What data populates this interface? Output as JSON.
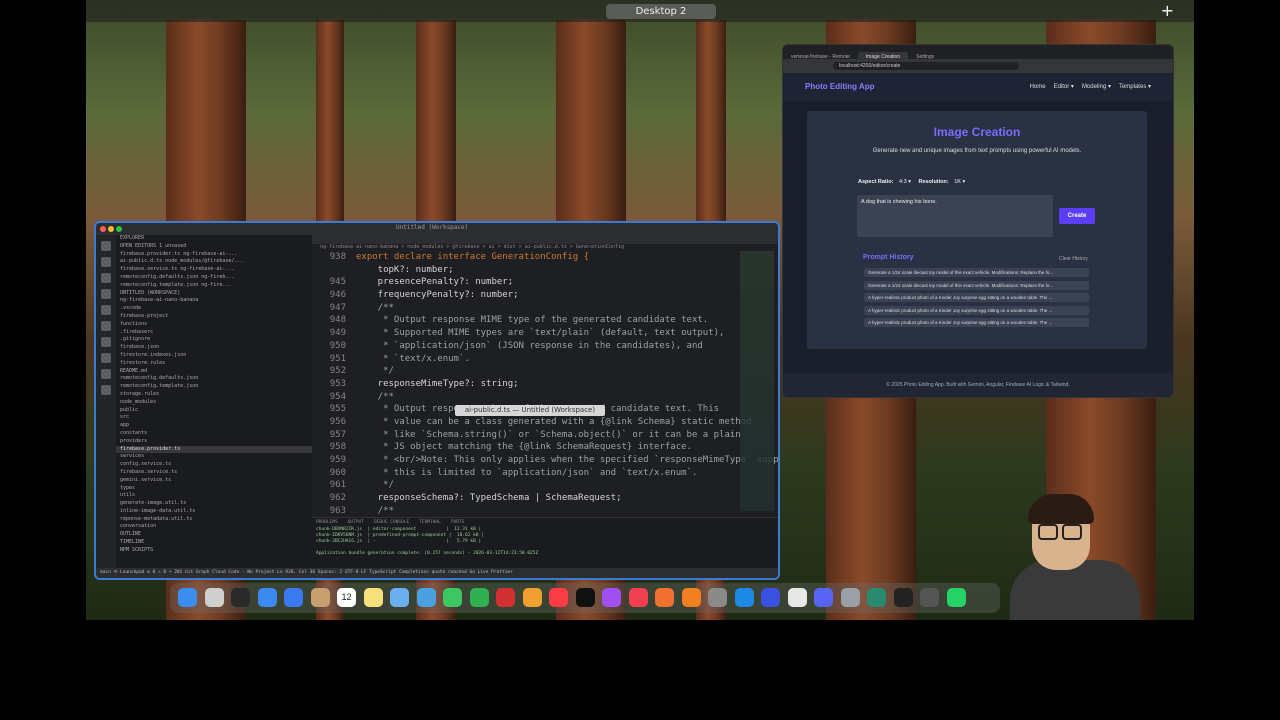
{
  "desktop": {
    "space_label": "Desktop 2",
    "add_label": "+"
  },
  "vscode": {
    "title": "Untitled (Workspace)",
    "explorer": [
      "EXPLORER",
      "OPEN EDITORS  1 unsaved",
      "  firebase.provider.ts  ng-firebase-ai-...",
      "  ai-public.d.ts  node_modules/@firebase/...",
      "  firebase.service.ts  ng-firebase-ai-...",
      "  remoteconfig.defaults.json  ng-fireb...",
      "  remoteconfig.template.json  ng-fire...",
      "UNTITLED (WORKSPACE)",
      "  ng-firebase-ai-nano-banana",
      "    .vscode",
      "    firebase-project",
      "      functions",
      "      .firebaserc",
      "      .gitignore",
      "      firebase.json",
      "      firestore.indexes.json",
      "      firestore.rules",
      "      README.md",
      "      remoteconfig.defaults.json",
      "      remoteconfig.template.json",
      "      storage.rules",
      "    node_modules",
      "    public",
      "    src",
      "      app",
      "        constants",
      "        providers",
      "          firebase.provider.ts",
      "        services",
      "          config.service.ts",
      "          firebase.service.ts",
      "          gemini.service.ts",
      "        types",
      "        utils",
      "          generate-image.util.ts",
      "          inline-image-data.util.ts",
      "          reponse-metadata.util.ts",
      "    conversation",
      "  OUTLINE",
      "  TIMELINE",
      "  NPM SCRIPTS"
    ],
    "tabs": [
      "firebase.provider.ts",
      "ai-public.d.ts",
      "firebase.service.ts",
      "remoteconfig.defaults.json",
      "remoteconfig.template.json"
    ],
    "breadcrumb": "ng-firebase-ai-nano-banana > node_modules > @firebase > ai > dist > ai-public.d.ts > GenerationConfig",
    "code": [
      {
        "n": "938",
        "t": "export declare interface GenerationConfig {",
        "k": "hdr"
      },
      {
        "n": "",
        "t": "    topK?: number;",
        "k": "plain"
      },
      {
        "n": "945",
        "t": "    presencePenalty?: number;",
        "k": "plain"
      },
      {
        "n": "946",
        "t": "    frequencyPenalty?: number;",
        "k": "plain"
      },
      {
        "n": "947",
        "t": "    /**",
        "k": "cm"
      },
      {
        "n": "948",
        "t": "     * Output response MIME type of the generated candidate text.",
        "k": "cm"
      },
      {
        "n": "949",
        "t": "     * Supported MIME types are `text/plain` (default, text output),",
        "k": "cm"
      },
      {
        "n": "950",
        "t": "     * `application/json` (JSON response in the candidates), and",
        "k": "cm"
      },
      {
        "n": "951",
        "t": "     * `text/x.enum`.",
        "k": "cm"
      },
      {
        "n": "952",
        "t": "     */",
        "k": "cm"
      },
      {
        "n": "953",
        "t": "    responseMimeType?: string;",
        "k": "plain"
      },
      {
        "n": "954",
        "t": "    /**",
        "k": "cm"
      },
      {
        "n": "955",
        "t": "     * Output response schema of the generated candidate text. This",
        "k": "cm"
      },
      {
        "n": "956",
        "t": "     * value can be a class generated with a {@link Schema} static method",
        "k": "cm"
      },
      {
        "n": "957",
        "t": "     * like `Schema.string()` or `Schema.object()` or it can be a plain",
        "k": "cm"
      },
      {
        "n": "958",
        "t": "     * JS object matching the {@link SchemaRequest} interface.",
        "k": "cm"
      },
      {
        "n": "959",
        "t": "     * <br/>Note: This only applies when the specified `responseMimeType` supports a schema;",
        "k": "cm"
      },
      {
        "n": "960",
        "t": "     * this is limited to `application/json` and `text/x.enum`.",
        "k": "cm"
      },
      {
        "n": "961",
        "t": "     */",
        "k": "cm"
      },
      {
        "n": "962",
        "t": "    responseSchema?: TypedSchema | SchemaRequest;",
        "k": "plain"
      },
      {
        "n": "963",
        "t": "    /**",
        "k": "cm"
      }
    ],
    "tooltip": "ai-public.d.ts — Untitled (Workspace)",
    "panel_tabs": [
      "PROBLEMS",
      "OUTPUT",
      "DEBUG CONSOLE",
      "TERMINAL",
      "PORTS"
    ],
    "terminal": [
      "chunk-DBVNR2IK.js  | editor-component           |  12.31 kB |",
      "chunk-IDKV56NM.js  | predefined-prompt-component |  10.62 kB |",
      "chunk-2BC2HAC6.js  | -                          |   5.79 kB |",
      "",
      "Application bundle generation complete. [0.157 seconds] - 2026-03-12T14:23:50.025Z"
    ],
    "statusbar": "main  ⟲  Launchpad  ⊗ 0 ⚠ 0  ⑂ 285  Git Graph  Cloud Code - No Project          Ln 938, Col 36   Spaces: 2   UTF-8   LF   TypeScript   Completions quota reached   Go Live   Prettier"
  },
  "chrome": {
    "tabs": [
      "vertexai-firebase - Remote",
      "Image Creation",
      "Settings"
    ],
    "address": "localhost:4200/editor/create",
    "app": {
      "brand": "Photo Editing App",
      "menu": [
        "Home",
        "Editor ▾",
        "Modeling ▾",
        "Templates ▾"
      ],
      "title": "Image Creation",
      "subtitle": "Generate new and unique images from text prompts using powerful AI models.",
      "aspect_label": "Aspect Ratio:",
      "aspect_value": "4:3",
      "resolution_label": "Resolution:",
      "resolution_value": "1K",
      "prompt_value": "A dog that is chewing his bone.",
      "create_label": "Create",
      "history_title": "Prompt History",
      "clear_label": "Clear History",
      "history": [
        "Generate a 1/24 scale diecast toy model of this exact vehicle. Modifications: Replace the fo...",
        "Generate a 1/24 scale diecast toy model of this exact vehicle. Modifications: Replace the fo...",
        "A hyper-realistic product photo of a Kinder Joy surprise egg sitting on a wooden table. The ...",
        "A hyper-realistic product photo of a Kinder Joy surprise egg sitting on a wooden table. The ...",
        "A hyper-realistic product photo of a Kinder Joy surprise egg sitting on a wooden table. The ..."
      ],
      "footer": "© 2025 Photo Editing App. Built with Gemini, Angular, Firebase AI Logic & Tailwind."
    }
  },
  "dock": {
    "apps": [
      "Finder",
      "Launchpad",
      "Mission Control",
      "Mail",
      "App Store",
      "Notes",
      "Calendar",
      "Stickies",
      "Freeform",
      "Preview",
      "Messages",
      "FaceTime",
      "Photo Booth",
      "Photos",
      "Music",
      "TV",
      "Podcasts",
      "News",
      "Firefox",
      "Books",
      "System Settings",
      "VS Code",
      "Arc",
      "Chrome",
      "Discord",
      "Screenshot",
      "Xcode",
      "Terminal",
      "Calculator",
      "WhatsApp"
    ],
    "colors": [
      "#3d8cf0",
      "#cfcfcf",
      "#2a2a2a",
      "#3a8af0",
      "#3a7af0",
      "#c8a070",
      "#ffffff",
      "#f5e07a",
      "#6ab0f0",
      "#4aa0e0",
      "#3cc760",
      "#30b050",
      "#d03030",
      "#f0a030",
      "#fc3c44",
      "#111111",
      "#a050f0",
      "#f04050",
      "#f07030",
      "#f08020",
      "#8a8a8a",
      "#1e88e5",
      "#3a50e0",
      "#e8e8e8",
      "#5865f2",
      "#9aa0a8",
      "#2a8a70",
      "#222222",
      "#555555",
      "#25d366"
    ],
    "calendar_day": "12"
  }
}
